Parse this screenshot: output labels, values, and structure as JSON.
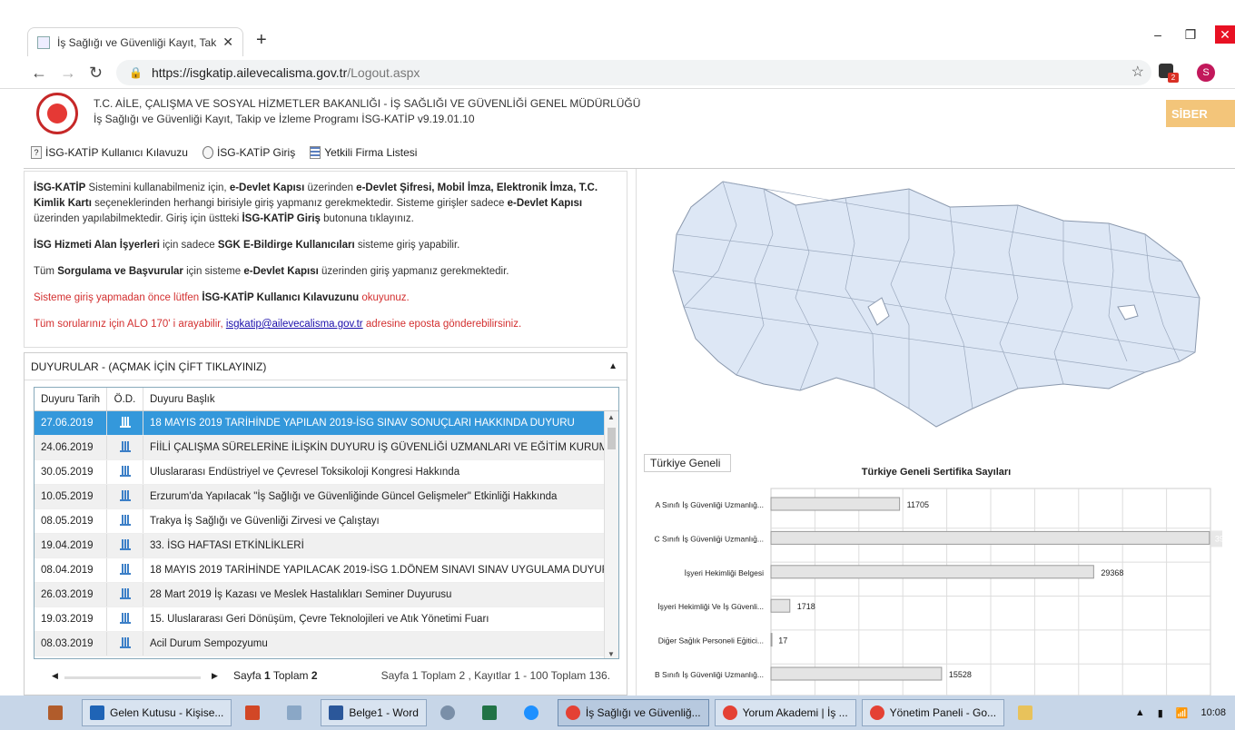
{
  "browser": {
    "tab_title": "İş Sağlığı ve Güvenliği Kayıt, Takip",
    "url_host": "https://isgkatip.ailevecalisma.gov.tr",
    "url_path": "/Logout.aspx",
    "ext_badge": "2",
    "profile_initial": "S"
  },
  "header": {
    "line1": "T.C. AİLE, ÇALIŞMA VE SOSYAL HİZMETLER BAKANLIĞI - İŞ SAĞLIĞI VE GÜVENLİĞİ GENEL MÜDÜRLÜĞÜ",
    "line2": "İş Sağlığı ve Güvenliği Kayıt, Takip ve İzleme Programı İSG-KATİP v9.19.01.10",
    "brand": "SİBER"
  },
  "toolbar": {
    "guide": "İSG-KATİP Kullanıcı Kılavuzu",
    "login": "İSG-KATİP Giriş",
    "firms": "Yetkili Firma Listesi"
  },
  "info": {
    "p1_a": "İSG-KATİP",
    "p1_b": " Sistemini kullanabilmeniz için, ",
    "p1_c": "e-Devlet Kapısı",
    "p1_d": " üzerinden ",
    "p1_e": "e-Devlet Şifresi, Mobil İmza, Elektronik İmza, T.C. Kimlik Kartı",
    "p1_f": " seçeneklerinden herhangi birisiyle giriş yapmanız gerekmektedir. Sisteme girişler sadece ",
    "p1_g": "e-Devlet Kapısı",
    "p1_h": " üzerinden yapılabilmektedir. Giriş için üstteki ",
    "p1_i": "İSG-KATİP Giriş",
    "p1_j": " butonuna tıklayınız.",
    "p2_a": "İSG Hizmeti Alan İşyerleri",
    "p2_b": " için sadece ",
    "p2_c": "SGK E-Bildirge Kullanıcıları",
    "p2_d": " sisteme giriş yapabilir.",
    "p3_a": "Tüm ",
    "p3_b": "Sorgulama ve Başvurular",
    "p3_c": " için sisteme ",
    "p3_d": "e-Devlet Kapısı",
    "p3_e": " üzerinden giriş yapmanız gerekmektedir.",
    "p4_a": "Sisteme giriş yapmadan önce lütfen ",
    "p4_b": "İSG-KATİP Kullanıcı Kılavuzunu",
    "p4_c": " okuyunuz.",
    "p5_a": "Tüm sorularınız için ALO 170' i arayabilir, ",
    "p5_link": "isgkatip@ailevecalisma.gov.tr",
    "p5_c": " adresine eposta gönderebilirsiniz."
  },
  "announcements": {
    "title": "DUYURULAR - (AÇMAK İÇİN ÇİFT TIKLAYINIZ)",
    "columns": [
      "Duyuru Tarih",
      "Ö.D.",
      "Duyuru Başlık"
    ],
    "rows": [
      {
        "date": "27.06.2019",
        "title": "18 MAYIS 2019 TARİHİNDE YAPILAN 2019-İSG SINAV SONUÇLARI HAKKINDA DUYURU"
      },
      {
        "date": "24.06.2019",
        "title": "FİİLİ ÇALIŞMA SÜRELERİNE İLİŞKİN DUYURU İŞ GÜVENLİĞİ UZMANLARI VE EĞİTİM KURUMLARI"
      },
      {
        "date": "30.05.2019",
        "title": "Uluslararası Endüstriyel ve Çevresel Toksikoloji Kongresi Hakkında"
      },
      {
        "date": "10.05.2019",
        "title": "Erzurum'da Yapılacak \"İş Sağlığı ve Güvenliğinde Güncel Gelişmeler\" Etkinliği Hakkında"
      },
      {
        "date": "08.05.2019",
        "title": "Trakya İş Sağlığı ve Güvenliği Zirvesi ve Çalıştayı"
      },
      {
        "date": "19.04.2019",
        "title": "33. İSG HAFTASI ETKİNLİKLERİ"
      },
      {
        "date": "08.04.2019",
        "title": "18 MAYIS 2019 TARİHİNDE YAPILACAK 2019-İSG 1.DÖNEM SINAVI SINAV UYGULAMA DUYURUSU"
      },
      {
        "date": "26.03.2019",
        "title": "28 Mart 2019 İş Kazası ve Meslek Hastalıkları Seminer Duyurusu"
      },
      {
        "date": "19.03.2019",
        "title": "15. Uluslararası Geri Dönüşüm, Çevre Teknolojileri ve Atık Yönetimi Fuarı"
      },
      {
        "date": "08.03.2019",
        "title": "Acil Durum Sempozyumu"
      }
    ],
    "pager_a": "Sayfa ",
    "pager_b": "1",
    "pager_c": " Toplam ",
    "pager_d": "2",
    "summary": "Sayfa 1 Toplam 2 , Kayıtlar 1 - 100 Toplam 136."
  },
  "stats_tab": "Türkiye Geneli",
  "chart_data": {
    "type": "bar",
    "title": "Türkiye Geneli Sertifika Sayıları",
    "categories": [
      "A Sınıfı İş Güvenliği Uzmanlığ...",
      "C Sınıfı İş Güvenliği Uzmanlığ...",
      "İşyeri Hekimliği Belgesi",
      "İşyeri Hekimliği Ve İş Güvenli...",
      "Diğer Sağlık Personeli Eğitici...",
      "B Sınıfı İş Güvenliği Uzmanlığ..."
    ],
    "values": [
      11705,
      39904,
      29368,
      1718,
      17,
      15528
    ],
    "xlim": [
      0,
      40000
    ],
    "grid": true,
    "colors": {
      "bar": "#e4e4e4",
      "bar_border": "#9a9a9a"
    }
  },
  "taskbar": {
    "items": [
      {
        "label": "Gelen Kutusu - Kişise..."
      },
      {
        "label": ""
      },
      {
        "label": ""
      },
      {
        "label": "Belge1 - Word"
      },
      {
        "label": ""
      },
      {
        "label": ""
      },
      {
        "label": ""
      },
      {
        "label": "İş Sağlığı ve Güvenliğ..."
      },
      {
        "label": "Yorum Akademi | İş ..."
      },
      {
        "label": "Yönetim Paneli - Go..."
      },
      {
        "label": ""
      }
    ],
    "time": "10:08"
  }
}
